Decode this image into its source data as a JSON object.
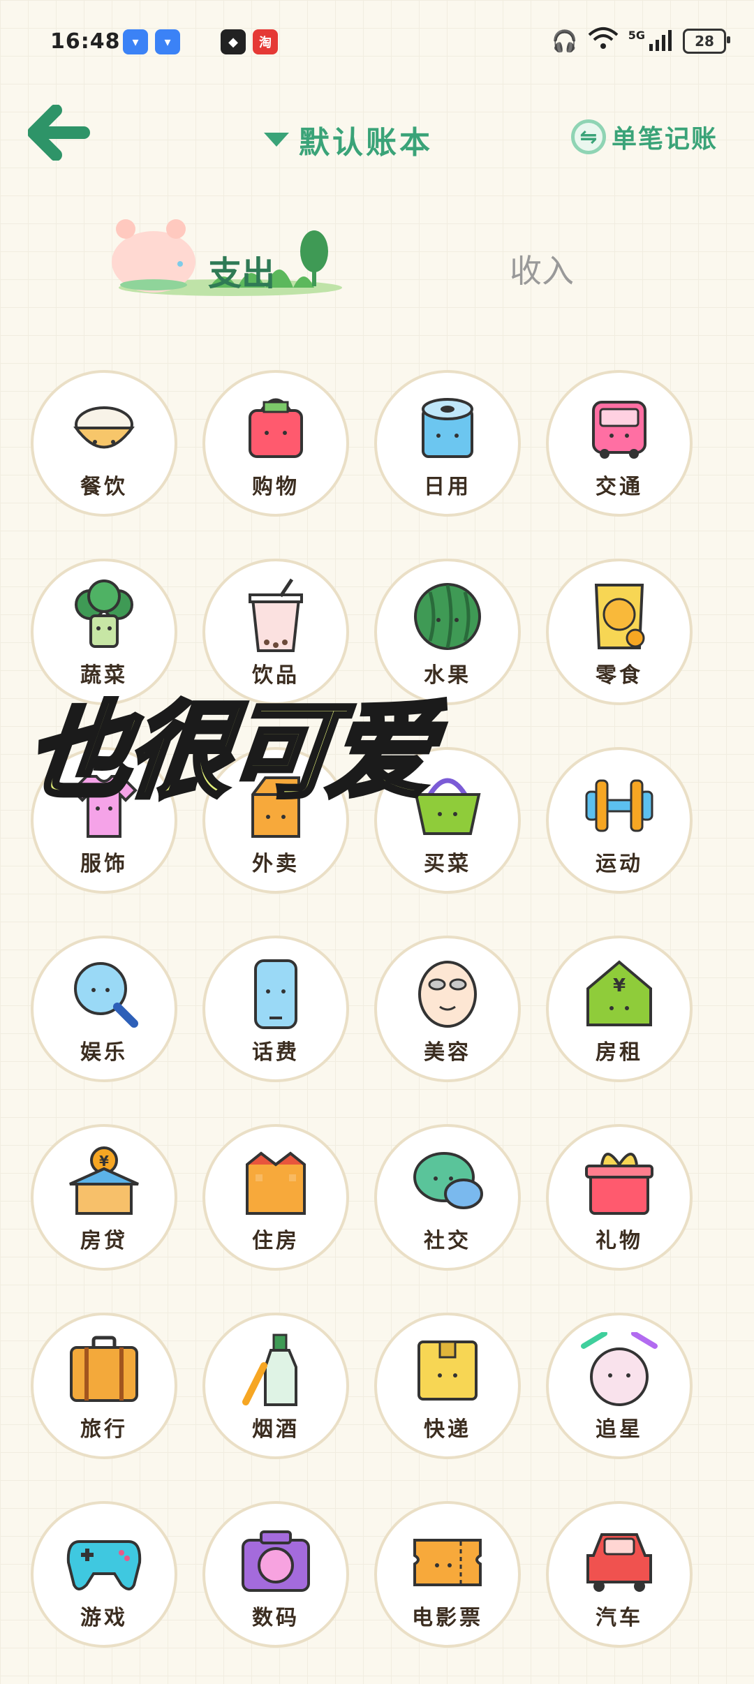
{
  "status_bar": {
    "time": "16:48",
    "apps": [
      {
        "icon": "app-icon-blue-1",
        "color": "#3b82f6"
      },
      {
        "icon": "app-icon-blue-2",
        "color": "#3b82f6"
      },
      {
        "icon": "app-icon-dark",
        "color": "#222222"
      },
      {
        "icon": "taobao-icon",
        "color": "#e53935",
        "label": "淘"
      }
    ],
    "network": "5G",
    "battery": "28"
  },
  "header": {
    "ledger_title": "默认账本",
    "single_entry_label": "单笔记账"
  },
  "tabs": {
    "expense": "支出",
    "income": "收入"
  },
  "overlay_caption": "也很可爱",
  "categories": [
    {
      "label": "餐饮",
      "icon": "rice-bowl-icon"
    },
    {
      "label": "购物",
      "icon": "shopping-bag-icon"
    },
    {
      "label": "日用",
      "icon": "toilet-roll-icon"
    },
    {
      "label": "交通",
      "icon": "bus-icon"
    },
    {
      "label": "蔬菜",
      "icon": "broccoli-icon"
    },
    {
      "label": "饮品",
      "icon": "bubble-tea-icon"
    },
    {
      "label": "水果",
      "icon": "watermelon-icon"
    },
    {
      "label": "零食",
      "icon": "snack-bag-icon"
    },
    {
      "label": "服饰",
      "icon": "tshirt-icon"
    },
    {
      "label": "外卖",
      "icon": "takeout-box-icon"
    },
    {
      "label": "买菜",
      "icon": "basket-icon"
    },
    {
      "label": "运动",
      "icon": "dumbbell-icon"
    },
    {
      "label": "娱乐",
      "icon": "microphone-icon"
    },
    {
      "label": "话费",
      "icon": "phone-icon"
    },
    {
      "label": "美容",
      "icon": "face-mask-icon"
    },
    {
      "label": "房租",
      "icon": "house-yuan-icon"
    },
    {
      "label": "房贷",
      "icon": "house-coin-icon"
    },
    {
      "label": "住房",
      "icon": "building-icon"
    },
    {
      "label": "社交",
      "icon": "chat-bubble-icon"
    },
    {
      "label": "礼物",
      "icon": "gift-icon"
    },
    {
      "label": "旅行",
      "icon": "suitcase-icon"
    },
    {
      "label": "烟酒",
      "icon": "bottle-icon"
    },
    {
      "label": "快递",
      "icon": "parcel-icon"
    },
    {
      "label": "追星",
      "icon": "glowsticks-icon"
    },
    {
      "label": "游戏",
      "icon": "gamepad-icon"
    },
    {
      "label": "数码",
      "icon": "camera-icon"
    },
    {
      "label": "电影票",
      "icon": "ticket-icon"
    },
    {
      "label": "汽车",
      "icon": "car-icon"
    }
  ],
  "colors": {
    "accent": "#3aa378",
    "background": "#fbf8ee",
    "cell_border": "#eadfc6"
  }
}
